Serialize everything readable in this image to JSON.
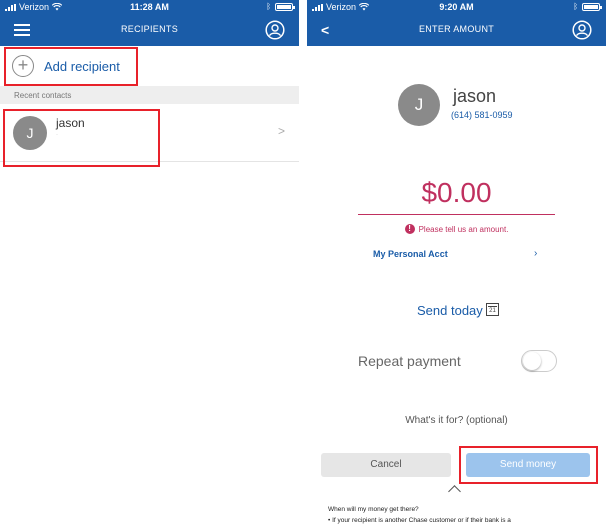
{
  "left_screen": {
    "status": {
      "carrier": "Verizon",
      "time": "11:28 AM"
    },
    "nav": {
      "title": "RECIPIENTS"
    },
    "add_recipient": {
      "label": "Add recipient",
      "icon": "plus-icon"
    },
    "section_label": "Recent contacts",
    "contacts": [
      {
        "initial": "J",
        "name": "jason",
        "sub": "·"
      }
    ]
  },
  "right_screen": {
    "status": {
      "carrier": "Verizon",
      "time": "9:20 AM"
    },
    "nav": {
      "title": "ENTER AMOUNT"
    },
    "recipient": {
      "initial": "J",
      "name": "jason",
      "phone": "(614) 581-0959"
    },
    "amount": "$0.00",
    "error": "Please tell us an amount.",
    "account": {
      "label": "My Personal Acct",
      "chevron": "›"
    },
    "send_date": {
      "label": "Send today",
      "cal_day": "21"
    },
    "repeat_label": "Repeat payment",
    "repeat_enabled": false,
    "memo_placeholder": "What's it for? (optional)",
    "buttons": {
      "cancel": "Cancel",
      "send": "Send money"
    },
    "info": {
      "question": "When will my money get there?",
      "answer": "• If your recipient is another Chase customer or if their bank is a"
    }
  },
  "colors": {
    "brand_blue": "#1a5ca8",
    "error_red": "#c0305f",
    "highlight_red": "#e8212a",
    "send_disabled": "#9cc4ed"
  }
}
